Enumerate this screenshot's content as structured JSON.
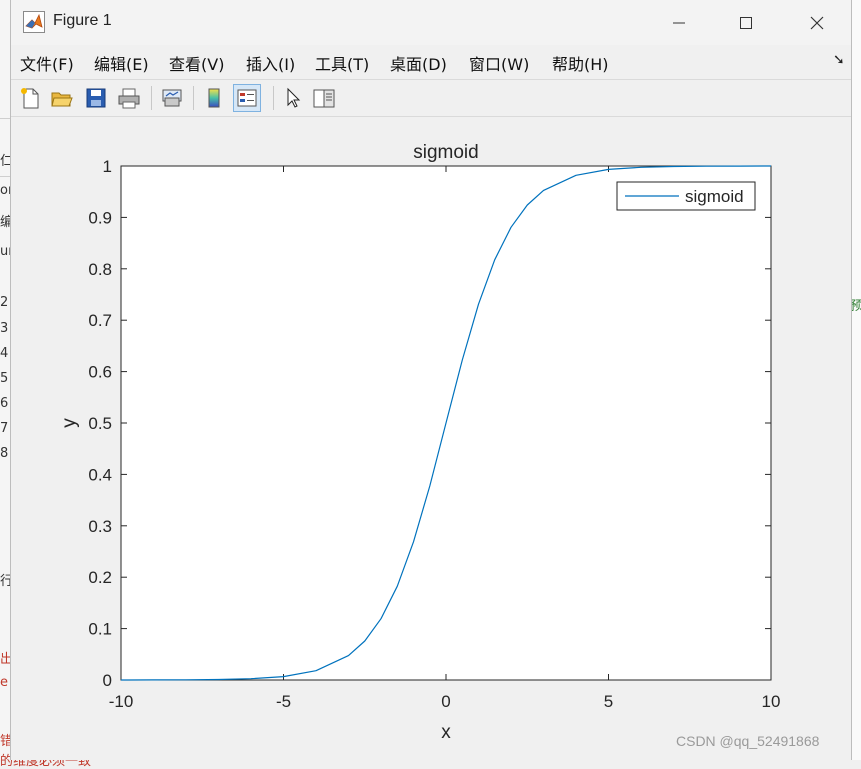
{
  "window": {
    "title": "Figure 1"
  },
  "menu": [
    {
      "label": "文件(F)"
    },
    {
      "label": "编辑(E)"
    },
    {
      "label": "查看(V)"
    },
    {
      "label": "插入(I)"
    },
    {
      "label": "工具(T)"
    },
    {
      "label": "桌面(D)"
    },
    {
      "label": "窗口(W)"
    },
    {
      "label": "帮助(H)"
    }
  ],
  "toolbar": {
    "icons": [
      "new-figure-icon",
      "open-file-icon",
      "save-icon",
      "print-icon",
      "link-plot-icon",
      "colorbar-icon",
      "legend-icon",
      "pointer-icon",
      "property-editor-icon"
    ],
    "active": "legend-icon"
  },
  "background_fragments": [
    {
      "text": "仁"
    },
    {
      "text": "on"
    },
    {
      "text": "编"
    },
    {
      "text": "ur"
    },
    {
      "text": "2"
    },
    {
      "text": "3"
    },
    {
      "text": "4"
    },
    {
      "text": "5"
    },
    {
      "text": "6"
    },
    {
      "text": "7"
    },
    {
      "text": "8"
    },
    {
      "text": "行"
    },
    {
      "text": "出"
    },
    {
      "text": "e"
    },
    {
      "text": "错"
    },
    {
      "text": "的维度必须一致"
    },
    {
      "text": "预"
    }
  ],
  "watermark": "CSDN @qq_52491868",
  "colors": {
    "series": "#0072bd",
    "axes": "#262626",
    "window_bg": "#f0f0f0"
  },
  "chart_data": {
    "type": "line",
    "title": "sigmoid",
    "xlabel": "x",
    "ylabel": "y",
    "xlim": [
      -10,
      10
    ],
    "ylim": [
      0,
      1
    ],
    "xticks": [
      -10,
      -5,
      0,
      5,
      10
    ],
    "yticks": [
      0,
      0.1,
      0.2,
      0.3,
      0.4,
      0.5,
      0.6,
      0.7,
      0.8,
      0.9,
      1
    ],
    "grid": false,
    "legend": {
      "position": "top-right",
      "entries": [
        "sigmoid"
      ]
    },
    "series": [
      {
        "name": "sigmoid",
        "color": "#0072bd",
        "x": [
          -10,
          -9,
          -8,
          -7,
          -6,
          -5,
          -4,
          -3,
          -2.5,
          -2,
          -1.5,
          -1,
          -0.5,
          0,
          0.5,
          1,
          1.5,
          2,
          2.5,
          3,
          4,
          5,
          6,
          7,
          8,
          9,
          10
        ],
        "y": [
          0.0,
          0.0001,
          0.0003,
          0.0009,
          0.0025,
          0.0067,
          0.018,
          0.0474,
          0.0759,
          0.1192,
          0.1824,
          0.2689,
          0.3775,
          0.5,
          0.6225,
          0.7311,
          0.8176,
          0.8808,
          0.9241,
          0.9526,
          0.982,
          0.9933,
          0.9975,
          0.9991,
          0.9997,
          0.9999,
          1.0
        ]
      }
    ]
  }
}
